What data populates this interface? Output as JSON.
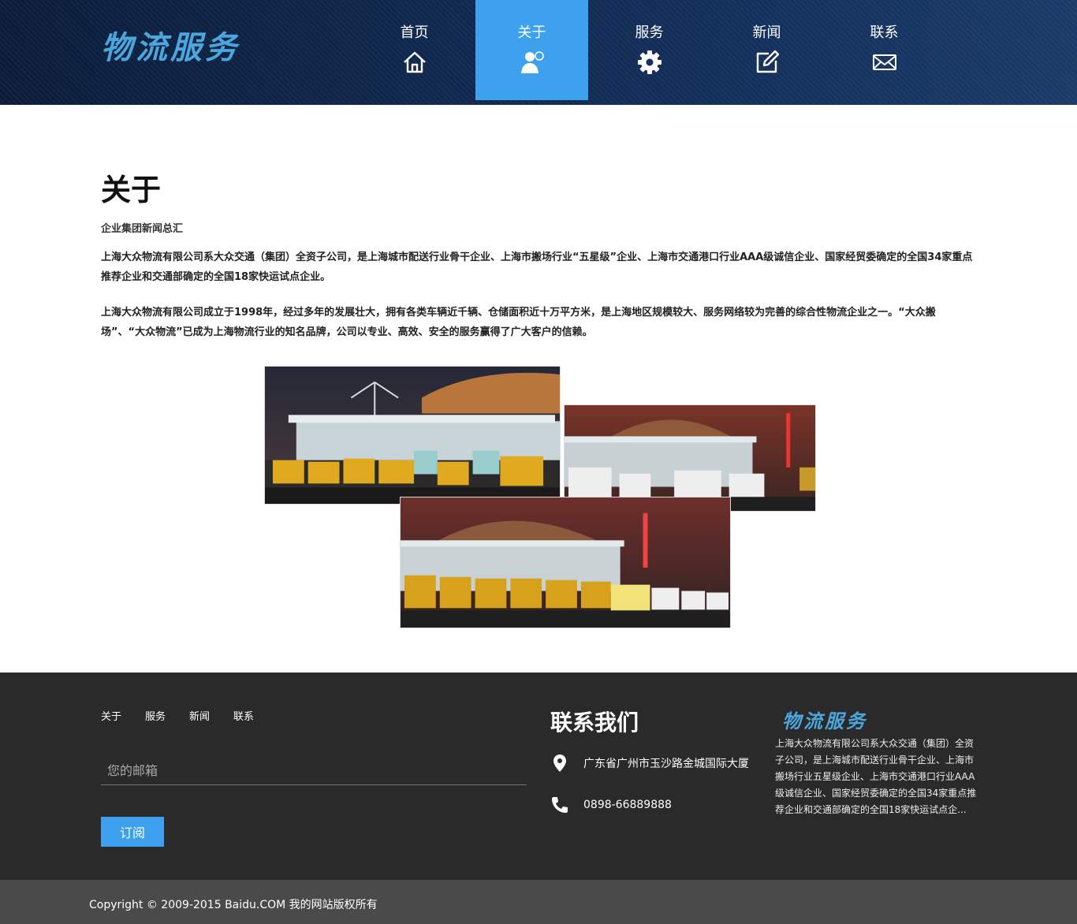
{
  "header": {
    "logo": "物流服务",
    "nav": [
      {
        "label": "首页",
        "icon": "home-icon"
      },
      {
        "label": "关于",
        "icon": "user-icon"
      },
      {
        "label": "服务",
        "icon": "gear-icon"
      },
      {
        "label": "新闻",
        "icon": "edit-icon"
      },
      {
        "label": "联系",
        "icon": "mail-icon"
      }
    ],
    "active_index": 1,
    "active_color": "#3da1ee"
  },
  "main": {
    "title": "关于",
    "subtitle": "企业集团新闻总汇",
    "paragraphs": [
      "上海大众物流有限公司系大众交通（集团）全资子公司，是上海城市配送行业骨干企业、上海市搬场行业“五星级”企业、上海市交通港口行业AAA级诚信企业、国家经贸委确定的全国34家重点推荐企业和交通部确定的全国18家快运试点企业。",
      "上海大众物流有限公司成立于1998年，经过多年的发展壮大，拥有各类车辆近千辆、仓储面积近十万平方米，是上海地区规模较大、服务网络较为完善的综合性物流企业之一。“大众搬场”、“大众物流”已成为上海物流行业的知名品牌，公司以专业、高效、安全的服务赢得了广大客户的信赖。"
    ],
    "photos": [
      "warehouse-night-photo-1",
      "warehouse-night-photo-2",
      "warehouse-night-photo-3"
    ]
  },
  "footer": {
    "links": [
      "关于",
      "服务",
      "新闻",
      "联系"
    ],
    "email_placeholder": "您的邮箱",
    "subscribe_label": "订阅",
    "contact_title": "联系我们",
    "address": "广东省广州市玉沙路金城国际大厦",
    "phone": "0898-66889888",
    "logo": "物流服务",
    "description": "上海大众物流有限公司系大众交通（集团）全资子公司，是上海城市配送行业骨干企业、上海市搬场行业五星级企业、上海市交通港口行业AAA级诚信企业、国家经贸委确定的全国34家重点推荐企业和交通部确定的全国18家快运试点企..."
  },
  "copyright": "Copyright © 2009-2015 Baidu.COM 我的网站版权所有"
}
